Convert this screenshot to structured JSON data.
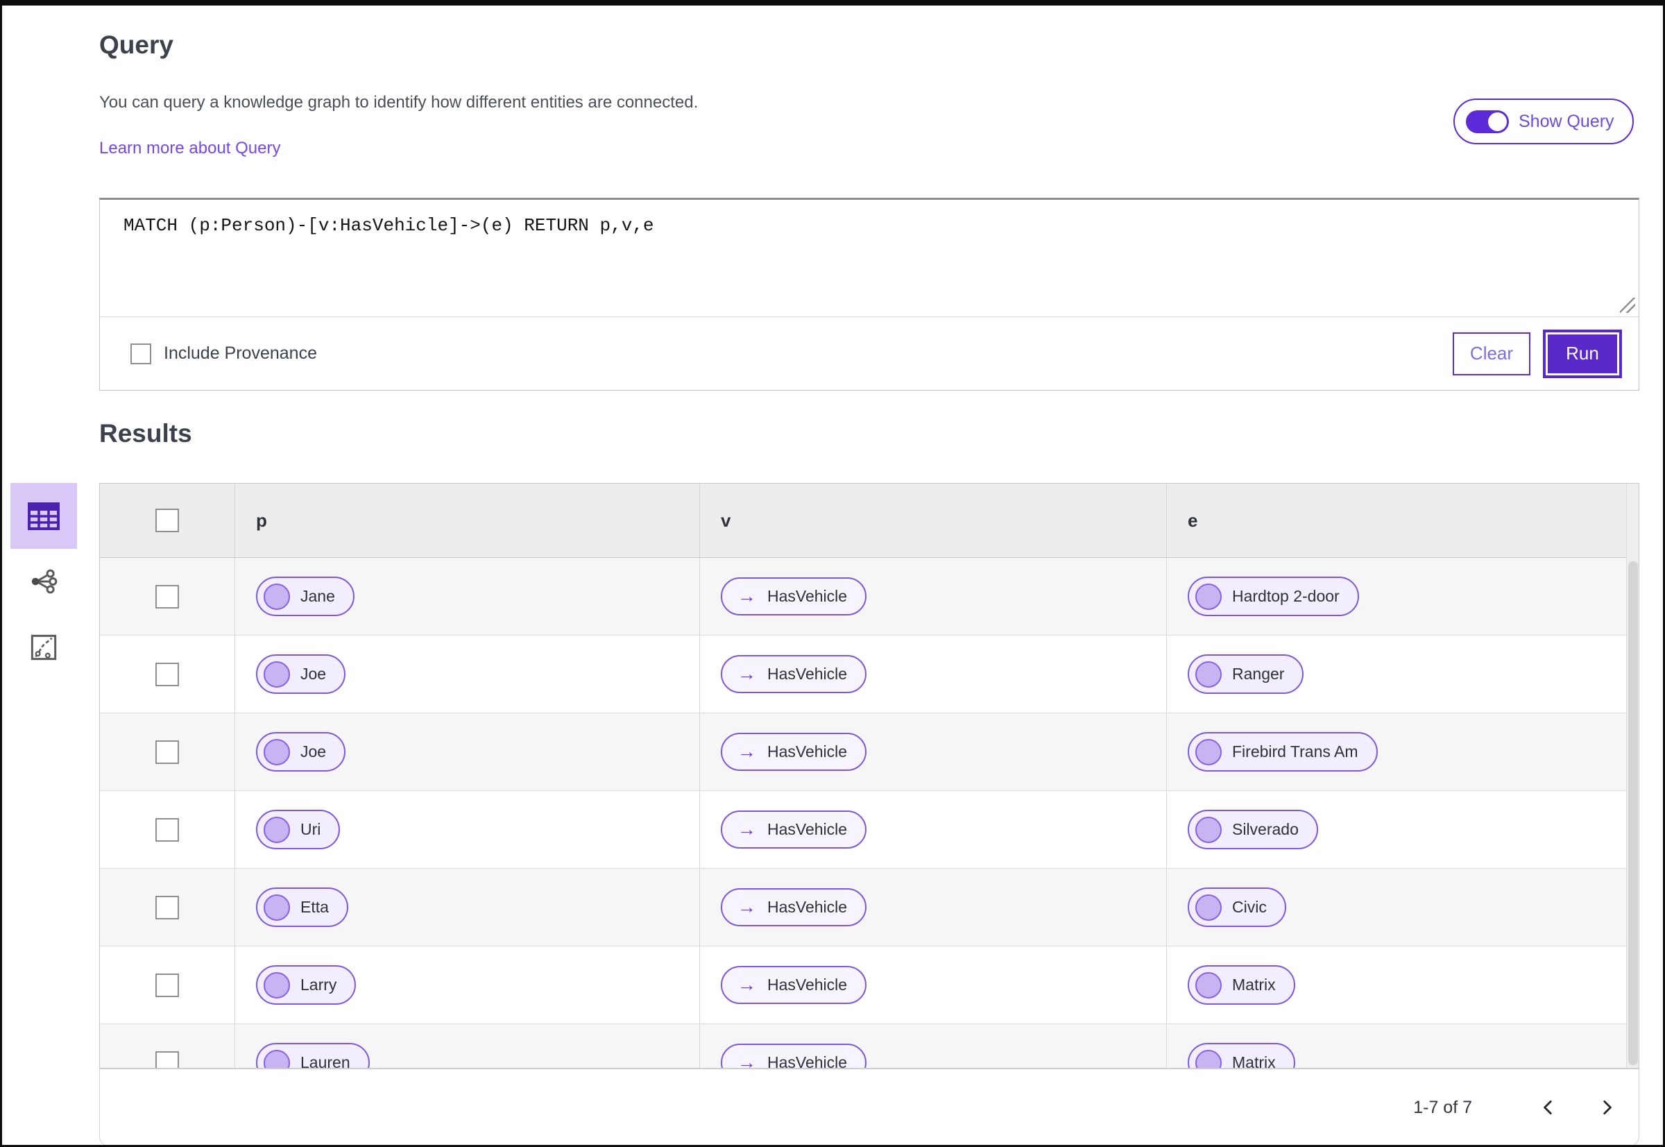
{
  "accent_colors": {
    "primary_purple": "#5a28c8",
    "outline_purple": "#5c2ad6",
    "link_purple": "#7646ec",
    "pill_border": "#7d57e0",
    "pill_background": "#f3eefd",
    "node_circle_fill": "#c8b4f2",
    "selected_view_background": "#d9c8f8",
    "table_header_background": "#ededed",
    "zebra_row_background": "#f6f6f6"
  },
  "icons": {
    "view_table": "table-grid-icon",
    "view_graph": "share-network-icon",
    "view_chart": "chart-route-icon",
    "edge_arrow": "→",
    "prev": "chevron-left-icon",
    "next": "chevron-right-icon",
    "resize": "resize-handle-icon",
    "node": "circle-node-icon"
  },
  "query": {
    "title": "Query",
    "description": "You can query a knowledge graph to identify how different entities are connected.",
    "learn_more_label": "Learn more about Query",
    "show_query_label": "Show Query",
    "show_query_on": true,
    "text": "MATCH (p:Person)-[v:HasVehicle]->(e) RETURN p,v,e",
    "include_provenance_label": "Include Provenance",
    "include_provenance_checked": false,
    "clear_label": "Clear",
    "run_label": "Run"
  },
  "results": {
    "title": "Results"
  },
  "table": {
    "columns": [
      "p",
      "v",
      "e"
    ],
    "rows": [
      {
        "p": "Jane",
        "v": "HasVehicle",
        "e": "Hardtop 2-door"
      },
      {
        "p": "Joe",
        "v": "HasVehicle",
        "e": "Ranger"
      },
      {
        "p": "Joe",
        "v": "HasVehicle",
        "e": "Firebird Trans Am"
      },
      {
        "p": "Uri",
        "v": "HasVehicle",
        "e": "Silverado"
      },
      {
        "p": "Etta",
        "v": "HasVehicle",
        "e": "Civic"
      },
      {
        "p": "Larry",
        "v": "HasVehicle",
        "e": "Matrix"
      },
      {
        "p": "Lauren",
        "v": "HasVehicle",
        "e": "Matrix"
      }
    ]
  },
  "pagination": {
    "range_label": "1-7 of 7"
  }
}
